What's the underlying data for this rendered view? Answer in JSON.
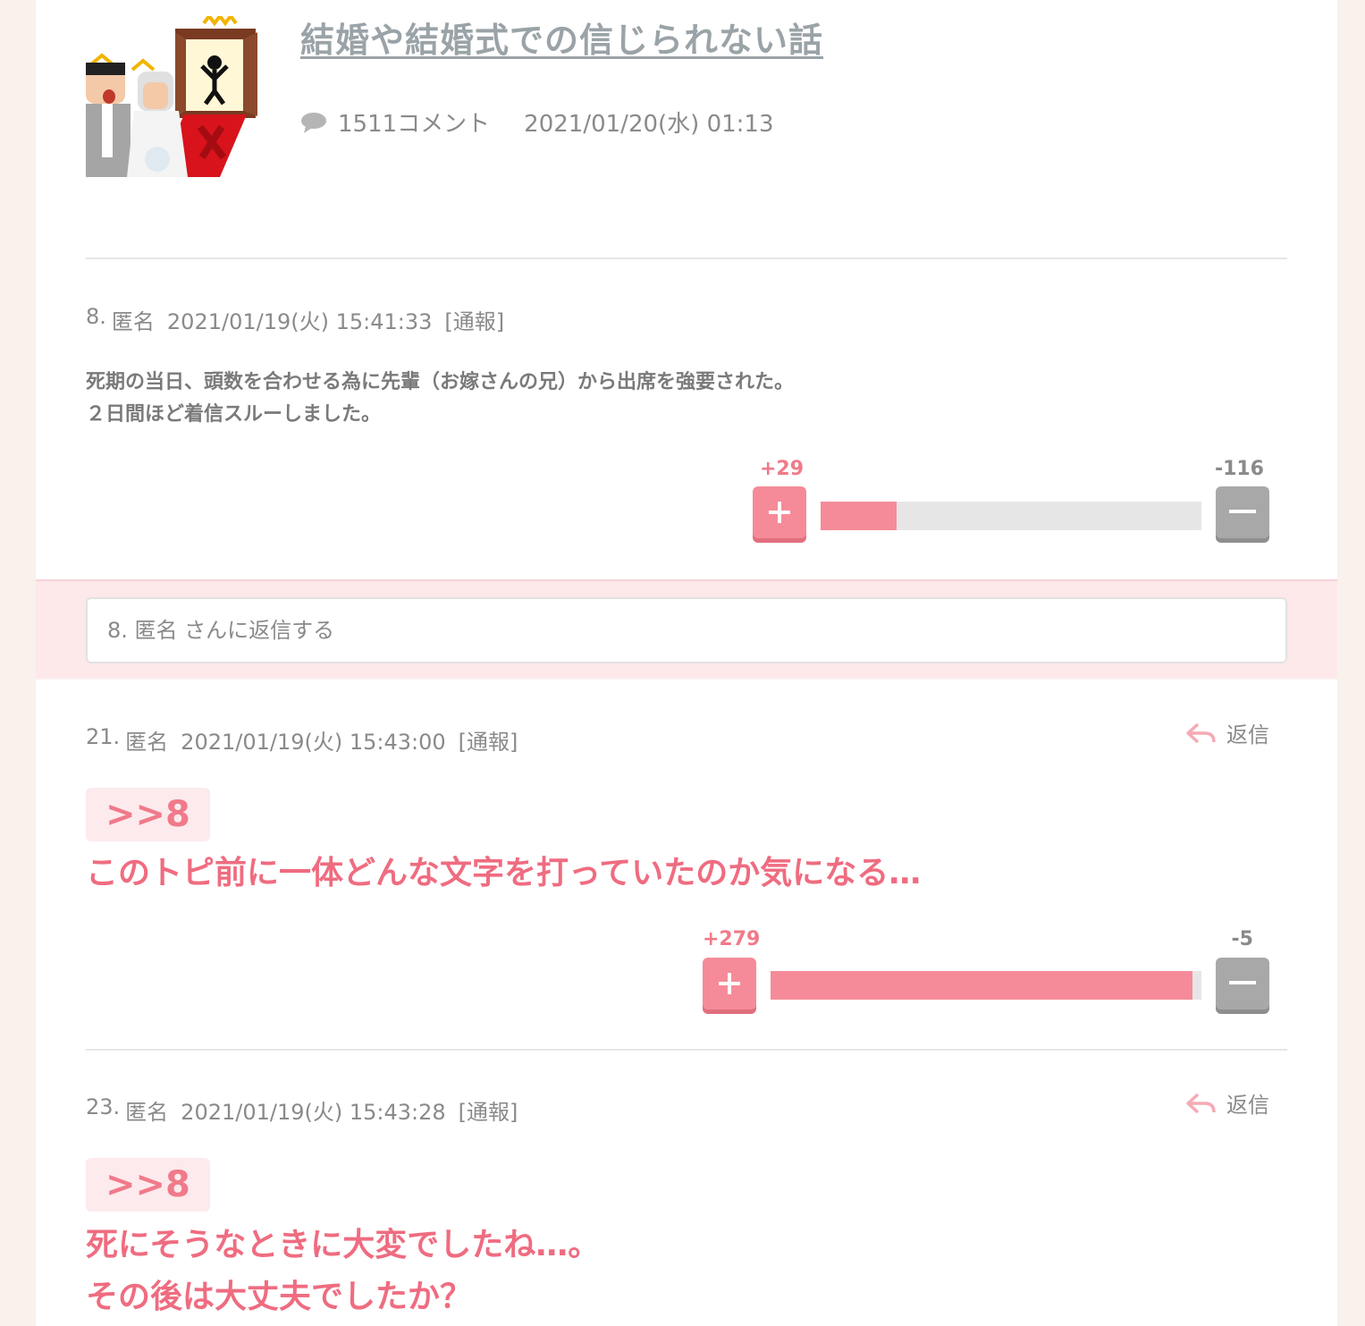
{
  "topic": {
    "title": "結婚や結婚式での信じられない話",
    "comment_count": "1511コメント",
    "posted_at": "2021/01/20(水) 01:13"
  },
  "comments": [
    {
      "number": "8.",
      "author": "匿名",
      "date": "2021/01/19(火) 15:41:33",
      "report": "[通報]",
      "lines": [
        "死期の当日、頭数を合わせる為に先輩（お嫁さんの兄）から出席を強要された。",
        "２日間ほど着信スルーしました。"
      ],
      "plus": "+29",
      "minus": "-116",
      "plus_ratio": 0.2
    },
    {
      "number": "21.",
      "author": "匿名",
      "date": "2021/01/19(火) 15:43:00",
      "report": "[通報]",
      "reply_label": "返信",
      "anchor": ">>8",
      "lines": [
        "このトピ前に一体どんな文字を打っていたのか気になる…"
      ],
      "plus": "+279",
      "minus": "-5",
      "plus_ratio": 0.98
    },
    {
      "number": "23.",
      "author": "匿名",
      "date": "2021/01/19(火) 15:43:28",
      "report": "[通報]",
      "reply_label": "返信",
      "anchor": ">>8",
      "lines": [
        "死にそうなときに大変でしたね…。",
        "その後は大丈夫でしたか？"
      ]
    }
  ],
  "reply_box": {
    "placeholder": "8. 匿名 さんに返信する"
  },
  "colors": {
    "accent": "#f58b98",
    "pink_text": "#ef6c80",
    "reply_band": "#fde8ea"
  },
  "icons": [
    "speech-bubble-icon",
    "plus-icon",
    "minus-icon",
    "reply-arrow-icon"
  ]
}
